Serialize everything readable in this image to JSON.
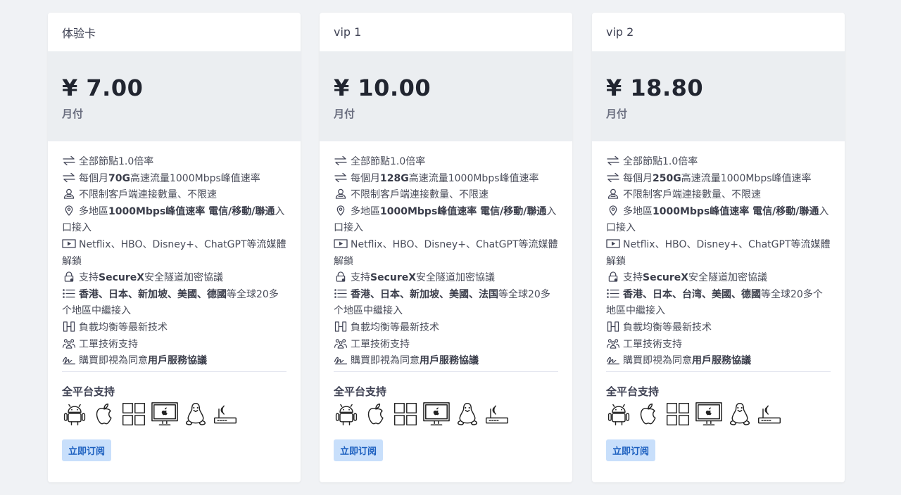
{
  "cards": [
    {
      "name": "体验卡",
      "price": "¥ 7.00",
      "period": "月付",
      "features": {
        "multiplier": "全部節點1.0倍率",
        "traffic_pre": "每個月",
        "traffic_bold": "70G",
        "traffic_post": "高速流量1000Mbps峰值速率",
        "conn": "不限制客戶端連接數量、不限速",
        "region_pre": "多地區",
        "region_bold": "1000Mbps峰值速率 電信/移動/聯通",
        "region_post": "入口接入",
        "media": "Netflix、HBO、Disney+、ChatGPT等流媒體解鎖",
        "secure_pre": "支持",
        "secure_bold": "SecureX",
        "secure_post": "安全隧道加密協議",
        "nodes_bold": "香港、日本、新加坡、美國、德國",
        "nodes_post": "等全球20多个地區中繼接入",
        "lb": "負載均衡等最新技术",
        "ticket": "工單技術支持",
        "tos_pre": "購買即視為同意",
        "tos_bold": "用戶服務協議"
      },
      "platform_title": "全平台支持",
      "button": "立即订阅"
    },
    {
      "name": "vip 1",
      "price": "¥ 10.00",
      "period": "月付",
      "features": {
        "multiplier": "全部節點1.0倍率",
        "traffic_pre": "每個月",
        "traffic_bold": "128G",
        "traffic_post": "高速流量1000Mbps峰值速率",
        "conn": "不限制客戶端連接數量、不限速",
        "region_pre": "多地區",
        "region_bold": "1000Mbps峰值速率 電信/移動/聯通",
        "region_post": "入口接入",
        "media": "Netflix、HBO、Disney+、ChatGPT等流媒體解鎖",
        "secure_pre": "支持",
        "secure_bold": "SecureX",
        "secure_post": "安全隧道加密協議",
        "nodes_bold": "香港、日本、新加坡、美國、法国",
        "nodes_post": "等全球20多个地區中繼接入",
        "lb": "負載均衡等最新技术",
        "ticket": "工單技術支持",
        "tos_pre": "購買即視為同意",
        "tos_bold": "用戶服務協議"
      },
      "platform_title": "全平台支持",
      "button": "立即订阅"
    },
    {
      "name": "vip 2",
      "price": "¥ 18.80",
      "period": "月付",
      "features": {
        "multiplier": "全部節點1.0倍率",
        "traffic_pre": "每個月",
        "traffic_bold": "250G",
        "traffic_post": "高速流量1000Mbps峰值速率",
        "conn": "不限制客戶端連接數量、不限速",
        "region_pre": "多地區",
        "region_bold": "1000Mbps峰值速率 電信/移動/聯通",
        "region_post": "入口接入",
        "media": "Netflix、HBO、Disney+、ChatGPT等流媒體解鎖",
        "secure_pre": "支持",
        "secure_bold": "SecureX",
        "secure_post": "安全隧道加密協議",
        "nodes_bold": "香港、日本、台湾、美國、德國",
        "nodes_post": "等全球20多个地區中繼接入",
        "lb": "負載均衡等最新技术",
        "ticket": "工單技術支持",
        "tos_pre": "購買即視為同意",
        "tos_bold": "用戶服務協議"
      },
      "platform_title": "全平台支持",
      "button": "立即订阅"
    }
  ],
  "feature_icons": [
    "swap-arrows-icon",
    "swap-arrows-icon",
    "users-icon",
    "location-pin-icon",
    "play-video-icon",
    "lock-icon",
    "list-icon",
    "load-balance-icon",
    "support-team-icon",
    "signature-icon"
  ],
  "platform_icons": [
    "android-icon",
    "apple-icon",
    "windows-icon",
    "macos-monitor-icon",
    "linux-icon",
    "router-icon"
  ],
  "colors": {
    "page_bg": "#f0f2f5",
    "card_bg": "#ffffff",
    "price_bg": "#ebeef1",
    "button_bg": "#c8dffb",
    "button_text": "#1b5fbf"
  }
}
